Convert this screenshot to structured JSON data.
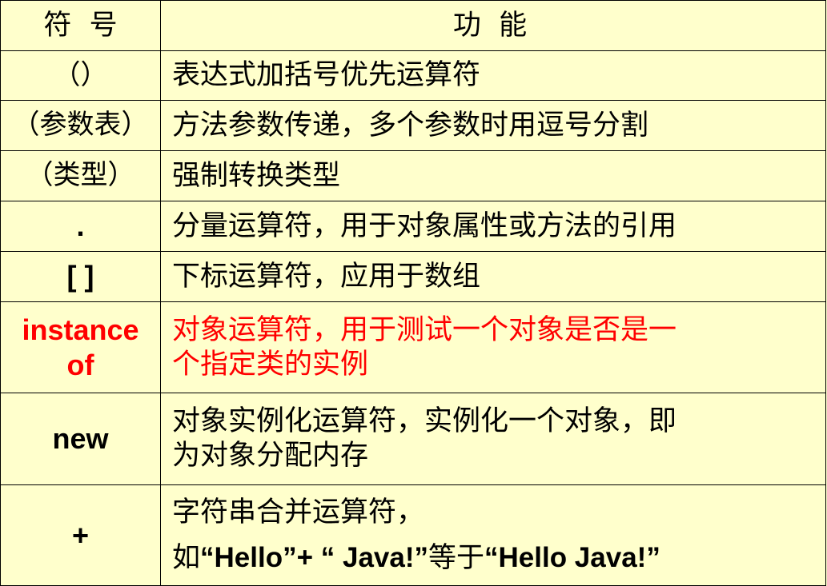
{
  "header": {
    "symbol": "符  号",
    "function": "功  能"
  },
  "rows": [
    {
      "symbol": "（）",
      "function": [
        "表达式加括号优先运算符"
      ]
    },
    {
      "symbol": "（参数表）",
      "function": [
        "方法参数传递，多个参数时用逗号分割"
      ]
    },
    {
      "symbol": "（类型）",
      "function": [
        "强制转换类型"
      ]
    },
    {
      "symbol": ".",
      "function": [
        "分量运算符，用于对象属性或方法的引用"
      ]
    },
    {
      "symbol": "[ ]",
      "function": [
        "下标运算符，应用于数组"
      ]
    },
    {
      "symbol": [
        "instance",
        "of"
      ],
      "function": [
        "对象运算符，用于测试一个对象是否是一",
        "个指定类的实例"
      ],
      "color": "#FF0000"
    },
    {
      "symbol": "new",
      "function": [
        "对象实例化运算符，实例化一个对象，即",
        "为对象分配内存"
      ]
    },
    {
      "symbol": "+",
      "function": [
        "字符串合并运算符，"
      ]
    }
  ],
  "plus_example": {
    "prefix": "如",
    "open_quote_1": "“",
    "hello_1": "Hello”+ “ Java!”",
    "middle": "等于",
    "open_quote_2": "“",
    "hello_2": "Hello Java!”"
  },
  "colors": {
    "background": "#FFFFCC",
    "border": "#000000",
    "text": "#000000",
    "highlight": "#FF0000"
  }
}
